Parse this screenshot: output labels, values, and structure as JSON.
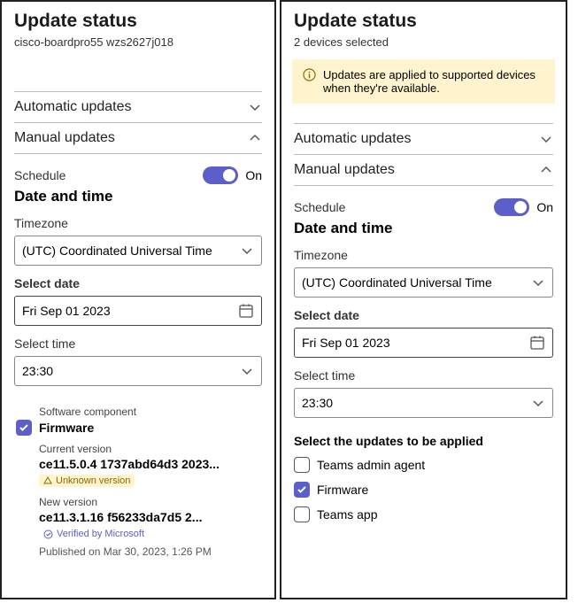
{
  "left": {
    "title": "Update status",
    "device": "cisco-boardpro55 wzs2627j018",
    "automatic_label": "Automatic updates",
    "manual_label": "Manual updates",
    "schedule_label": "Schedule",
    "toggle_state": "On",
    "datetime_heading": "Date and time",
    "tz_label": "Timezone",
    "tz_value": "(UTC) Coordinated Universal Time",
    "date_label": "Select date",
    "date_value": "Fri Sep 01 2023",
    "time_label": "Select time",
    "time_value": "23:30",
    "software_component_label": "Software component",
    "firmware_label": "Firmware",
    "current_label": "Current version",
    "current_value": "ce11.5.0.4 1737abd64d3 2023...",
    "unknown_tag": "Unknown version",
    "new_label": "New version",
    "new_value": "ce11.3.1.16 f56233da7d5 2...",
    "verified_tag": "Verified by Microsoft",
    "published": "Published on Mar 30, 2023, 1:26 PM"
  },
  "right": {
    "title": "Update status",
    "subtitle": "2 devices selected",
    "banner": "Updates are applied to supported devices when they're available.",
    "automatic_label": "Automatic updates",
    "manual_label": "Manual updates",
    "schedule_label": "Schedule",
    "toggle_state": "On",
    "datetime_heading": "Date and time",
    "tz_label": "Timezone",
    "tz_value": "(UTC) Coordinated Universal Time",
    "date_label": "Select date",
    "date_value": "Fri Sep 01 2023",
    "time_label": "Select time",
    "time_value": "23:30",
    "select_updates_label": "Select the updates to be applied",
    "opts": {
      "teams_admin": "Teams admin agent",
      "firmware": "Firmware",
      "teams_app": "Teams app"
    }
  }
}
